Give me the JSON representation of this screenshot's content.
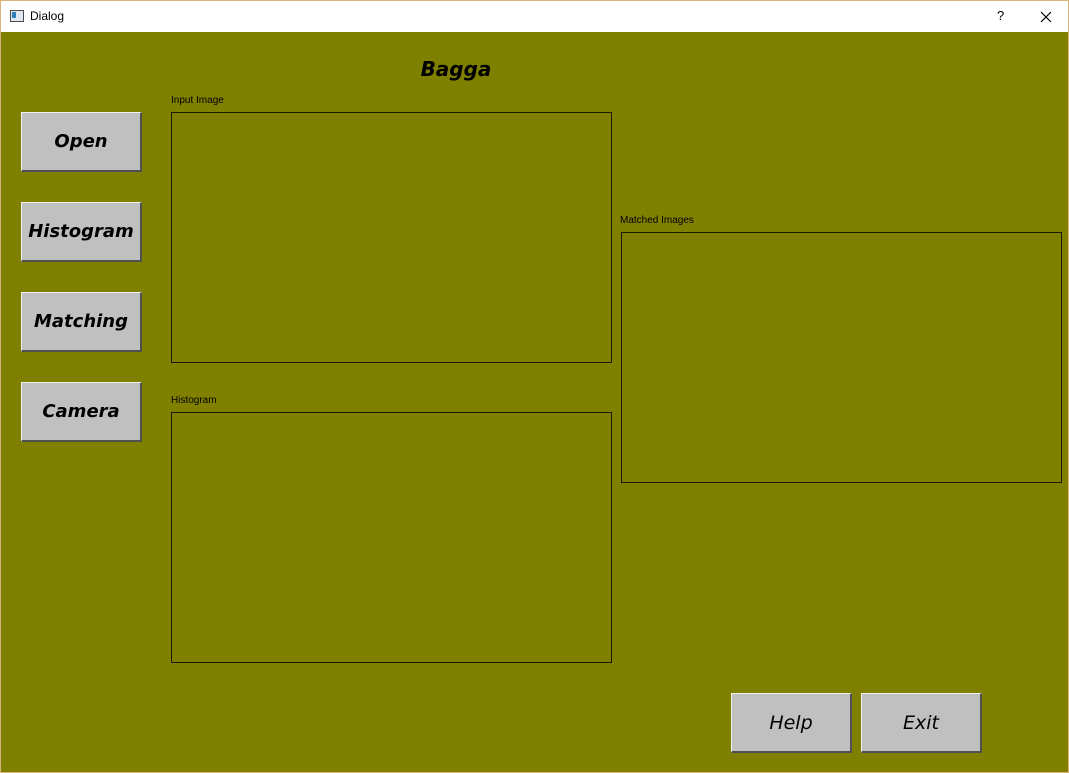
{
  "window": {
    "title": "Dialog",
    "help_glyph": "?",
    "close_icon": "close-icon"
  },
  "header": {
    "title": "Bagga"
  },
  "sidebar": {
    "open_label": "Open",
    "histogram_label": "Histogram",
    "matching_label": "Matching",
    "camera_label": "Camera"
  },
  "panels": {
    "input_image_label": "Input Image",
    "histogram_label": "Histogram",
    "matched_images_label": "Matched Images"
  },
  "footer": {
    "help_label": "Help",
    "exit_label": "Exit"
  },
  "colors": {
    "background": "#808000",
    "button_face": "#c0c0c0",
    "titlebar": "#ffffff"
  }
}
